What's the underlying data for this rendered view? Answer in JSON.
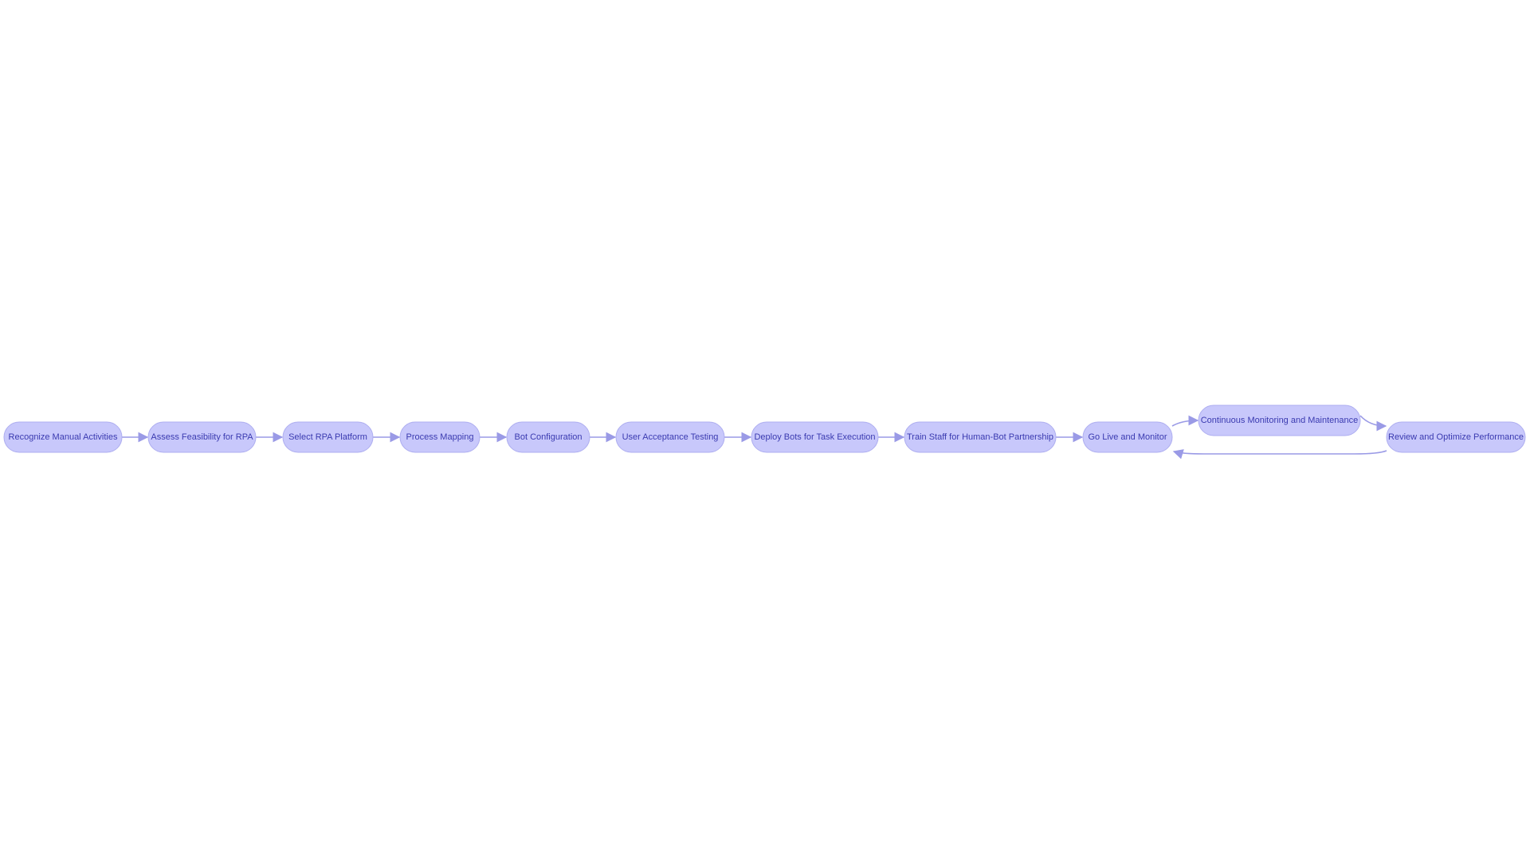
{
  "diagram": {
    "type": "flowchart",
    "direction": "left-to-right",
    "colors": {
      "node_fill": "#c8c8fb",
      "node_stroke": "#aeaef0",
      "text": "#3a3ab0",
      "edge": "#9a9ae6"
    },
    "nodes": [
      {
        "id": "n1",
        "label": "Recognize Manual Activities"
      },
      {
        "id": "n2",
        "label": "Assess Feasibility for RPA"
      },
      {
        "id": "n3",
        "label": "Select RPA Platform"
      },
      {
        "id": "n4",
        "label": "Process Mapping"
      },
      {
        "id": "n5",
        "label": "Bot Configuration"
      },
      {
        "id": "n6",
        "label": "User Acceptance Testing"
      },
      {
        "id": "n7",
        "label": "Deploy Bots for Task Execution"
      },
      {
        "id": "n8",
        "label": "Train Staff for Human-Bot Partnership"
      },
      {
        "id": "n9",
        "label": "Go Live and Monitor"
      },
      {
        "id": "n10",
        "label": "Continuous Monitoring and Maintenance"
      },
      {
        "id": "n11",
        "label": "Review and Optimize Performance"
      }
    ],
    "edges": [
      {
        "from": "n1",
        "to": "n2"
      },
      {
        "from": "n2",
        "to": "n3"
      },
      {
        "from": "n3",
        "to": "n4"
      },
      {
        "from": "n4",
        "to": "n5"
      },
      {
        "from": "n5",
        "to": "n6"
      },
      {
        "from": "n6",
        "to": "n7"
      },
      {
        "from": "n7",
        "to": "n8"
      },
      {
        "from": "n8",
        "to": "n9"
      },
      {
        "from": "n9",
        "to": "n10"
      },
      {
        "from": "n10",
        "to": "n11"
      },
      {
        "from": "n11",
        "to": "n9"
      }
    ]
  }
}
